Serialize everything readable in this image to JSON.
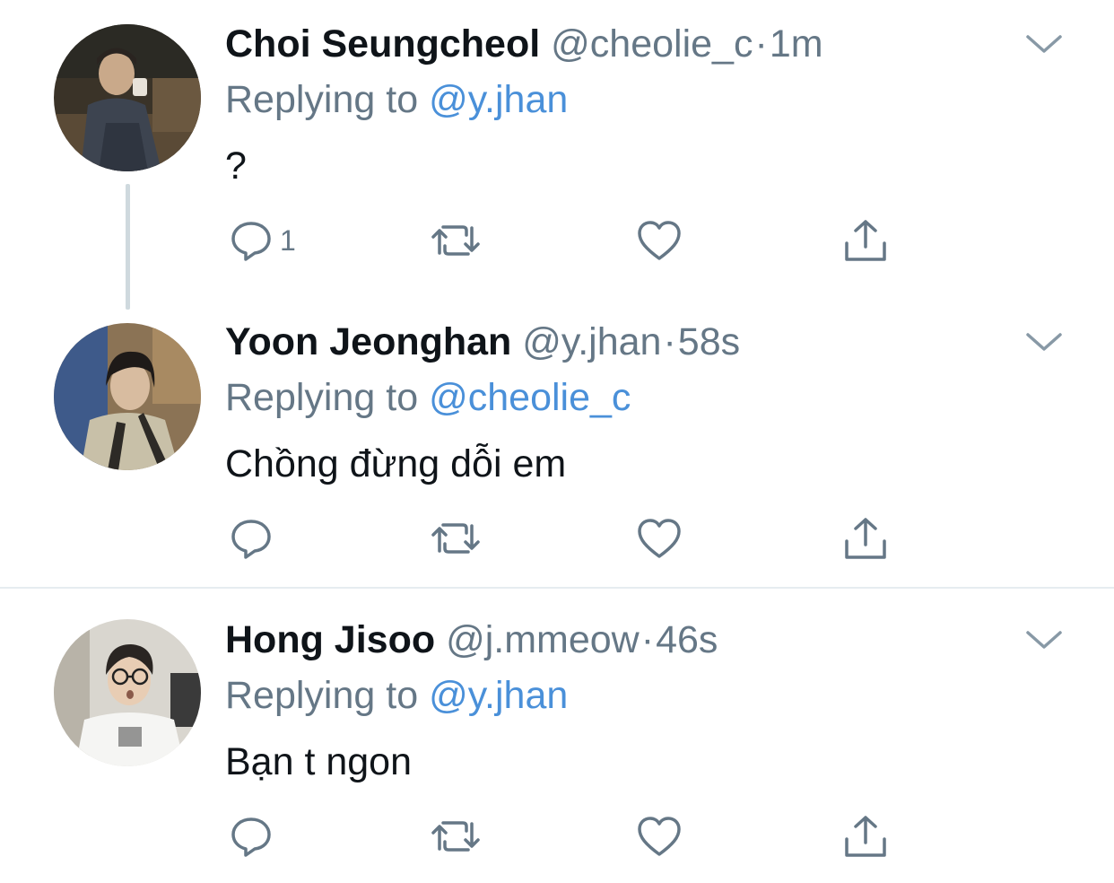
{
  "tweets": [
    {
      "name": "Choi Seungcheol",
      "handle": "@cheolie_c",
      "separator": "·",
      "time": "1m",
      "reply_prefix": "Replying to",
      "reply_to": "@y.jhan",
      "text": "?",
      "reply_count": "1",
      "avatar_icon": "avatar-photo"
    },
    {
      "name": "Yoon Jeonghan",
      "handle": "@y.jhan",
      "separator": "·",
      "time": "58s",
      "reply_prefix": "Replying to",
      "reply_to": "@cheolie_c",
      "text": "Chồng đừng dỗi em",
      "reply_count": "",
      "avatar_icon": "avatar-photo"
    },
    {
      "name": "Hong Jisoo",
      "handle": "@j.mmeow",
      "separator": "·",
      "time": "46s",
      "reply_prefix": "Replying to",
      "reply_to": "@y.jhan",
      "text": "Bạn t ngon",
      "reply_count": "",
      "avatar_icon": "avatar-photo"
    }
  ],
  "icons": {
    "reply": "reply-icon",
    "retweet": "retweet-icon",
    "like": "heart-icon",
    "share": "share-icon",
    "menu": "chevron-down-icon"
  },
  "colors": {
    "text": "#0f1419",
    "muted": "#657786",
    "link": "#4a90d9",
    "divider": "#e6ecf0",
    "thread_line": "#cfd9de"
  }
}
